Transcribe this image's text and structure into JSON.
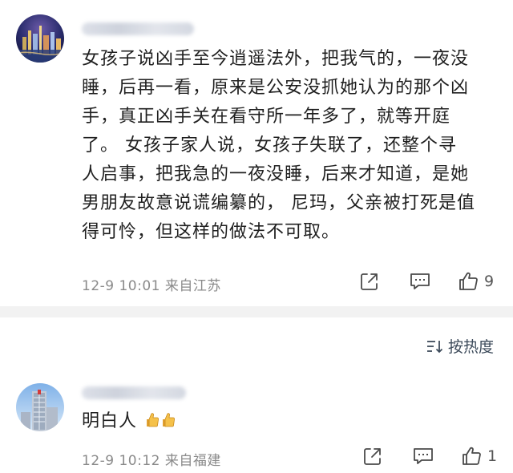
{
  "comments": [
    {
      "text_lines": [
        "女孩子说凶手至今逍遥法外，把我气的，一夜没",
        "睡，后再一看，原来是公安没抓她认为的那个凶",
        "手，真正凶手关在看守所一年多了，就等开庭",
        "了。 女孩子家人说，女孩子失联了，还整个寻",
        "人启事，把我急的一夜没睡，后来才知道，是她",
        "男朋友故意说谎编纂的， 尼玛，父亲被打死是值",
        "得可怜，但这样的做法不可取。"
      ],
      "meta": "12-9 10:01 来自江苏",
      "like_count": "9",
      "avatar_icon": "city-night-avatar-icon"
    },
    {
      "text": "明白人",
      "emoji": [
        "thumbs-up-icon",
        "thumbs-up-icon"
      ],
      "meta": "12-9 10:12 来自福建",
      "like_count": "1",
      "avatar_icon": "building-avatar-icon"
    }
  ],
  "sort": {
    "label": "按热度"
  },
  "colors": {
    "accent": "#3c4a5a",
    "meta": "#8a8a8a",
    "band": "#f2f2f2"
  }
}
